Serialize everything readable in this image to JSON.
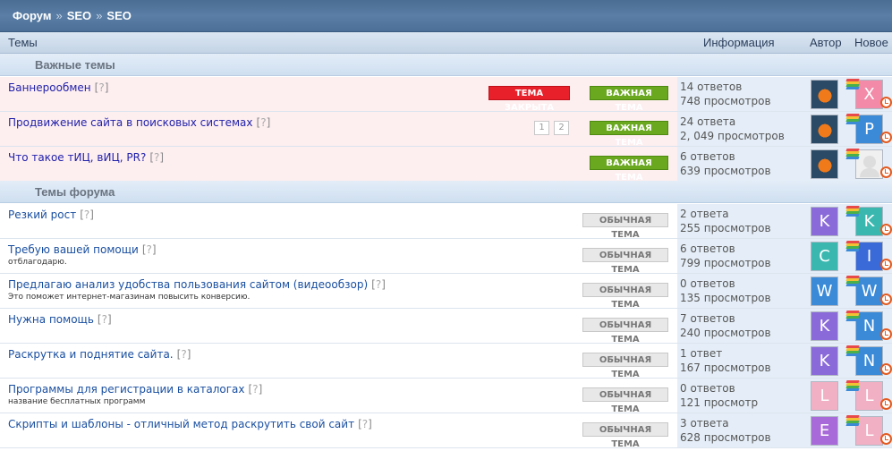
{
  "breadcrumb": {
    "items": [
      "Форум",
      "SEO",
      "SEO"
    ],
    "separator": "»"
  },
  "columns": {
    "topics": "Темы",
    "info": "Информация",
    "author": "Автор",
    "newest": "Новое"
  },
  "sections": {
    "important": "Важные темы",
    "forum": "Темы форума"
  },
  "colors": {
    "closed": "#e8202a",
    "important": "#6aa820",
    "ordinary": "#e8e8e8",
    "sticky_bg": "#fdeef0",
    "header": "#4a6d93"
  },
  "important_topics": [
    {
      "title": "Баннерообмен",
      "q": "?",
      "closed_badge": "ТЕМА ЗАКРЫТА",
      "badge": "ВАЖНАЯ ТЕМА",
      "replies": "14 ответов",
      "views": "748 просмотров",
      "author_avatar": "fox-avatar",
      "last_letter": "X",
      "last_color": "#f28aa8"
    },
    {
      "title": "Продвижение сайта в поисковых системах",
      "q": "?",
      "pages": [
        "1",
        "2"
      ],
      "badge": "ВАЖНАЯ ТЕМА",
      "replies": "24 ответа",
      "views": "2, 049 просмотров",
      "author_avatar": "fox-avatar",
      "last_letter": "P",
      "last_color": "#3a8ad8"
    },
    {
      "title": "Что такое тИЦ, вИЦ, PR?",
      "q": "?",
      "badge": "ВАЖНАЯ ТЕМА",
      "replies": "6 ответов",
      "views": "639 просмотров",
      "author_avatar": "fox-avatar",
      "last_letter": "",
      "last_color": "#f0f0f0"
    }
  ],
  "forum_topics": [
    {
      "title": "Резкий рост",
      "q": "?",
      "subtitle": "",
      "badge": "ОБЫЧНАЯ ТЕМА",
      "replies": "2 ответа",
      "views": "255 просмотров",
      "author_letter": "K",
      "author_color": "#8a6ad8",
      "last_letter": "K",
      "last_color": "#3ab8b0"
    },
    {
      "title": "Требую вашей помощи",
      "q": "?",
      "subtitle": "отблагодарю.",
      "badge": "ОБЫЧНАЯ ТЕМА",
      "replies": "6 ответов",
      "views": "799 просмотров",
      "author_letter": "C",
      "author_color": "#3ab8b0",
      "last_letter": "I",
      "last_color": "#3a6ad8"
    },
    {
      "title": "Предлагаю анализ удобства пользования сайтом (видеообзор)",
      "q": "?",
      "subtitle": "Это поможет интернет-магазинам повысить конверсию.",
      "badge": "ОБЫЧНАЯ ТЕМА",
      "replies": "0 ответов",
      "views": "135 просмотров",
      "author_letter": "W",
      "author_color": "#3a8ad8",
      "last_letter": "W",
      "last_color": "#3a8ad8"
    },
    {
      "title": "Нужна помощь",
      "q": "?",
      "subtitle": "",
      "badge": "ОБЫЧНАЯ ТЕМА",
      "replies": "7 ответов",
      "views": "240 просмотров",
      "author_letter": "K",
      "author_color": "#8a6ad8",
      "last_letter": "N",
      "last_color": "#3a8ad8"
    },
    {
      "title": "Раскрутка и поднятие сайта.",
      "q": "?",
      "subtitle": "",
      "badge": "ОБЫЧНАЯ ТЕМА",
      "replies": "1 ответ",
      "views": "167 просмотров",
      "author_letter": "K",
      "author_color": "#8a6ad8",
      "last_letter": "N",
      "last_color": "#3a8ad8"
    },
    {
      "title": "Программы для регистрации в каталогах",
      "q": "?",
      "subtitle": "название бесплатных программ",
      "badge": "ОБЫЧНАЯ ТЕМА",
      "replies": "0 ответов",
      "views": "121 просмотр",
      "author_letter": "L",
      "author_color": "#f2b0c4",
      "last_letter": "L",
      "last_color": "#f2b0c4"
    },
    {
      "title": "Скрипты и шаблоны - отличный метод раскрутить свой сайт",
      "q": "?",
      "subtitle": "",
      "badge": "ОБЫЧНАЯ ТЕМА",
      "replies": "3 ответа",
      "views": "628 просмотров",
      "author_letter": "E",
      "author_color": "#a86ad8",
      "last_letter": "L",
      "last_color": "#f2b0c4"
    }
  ]
}
